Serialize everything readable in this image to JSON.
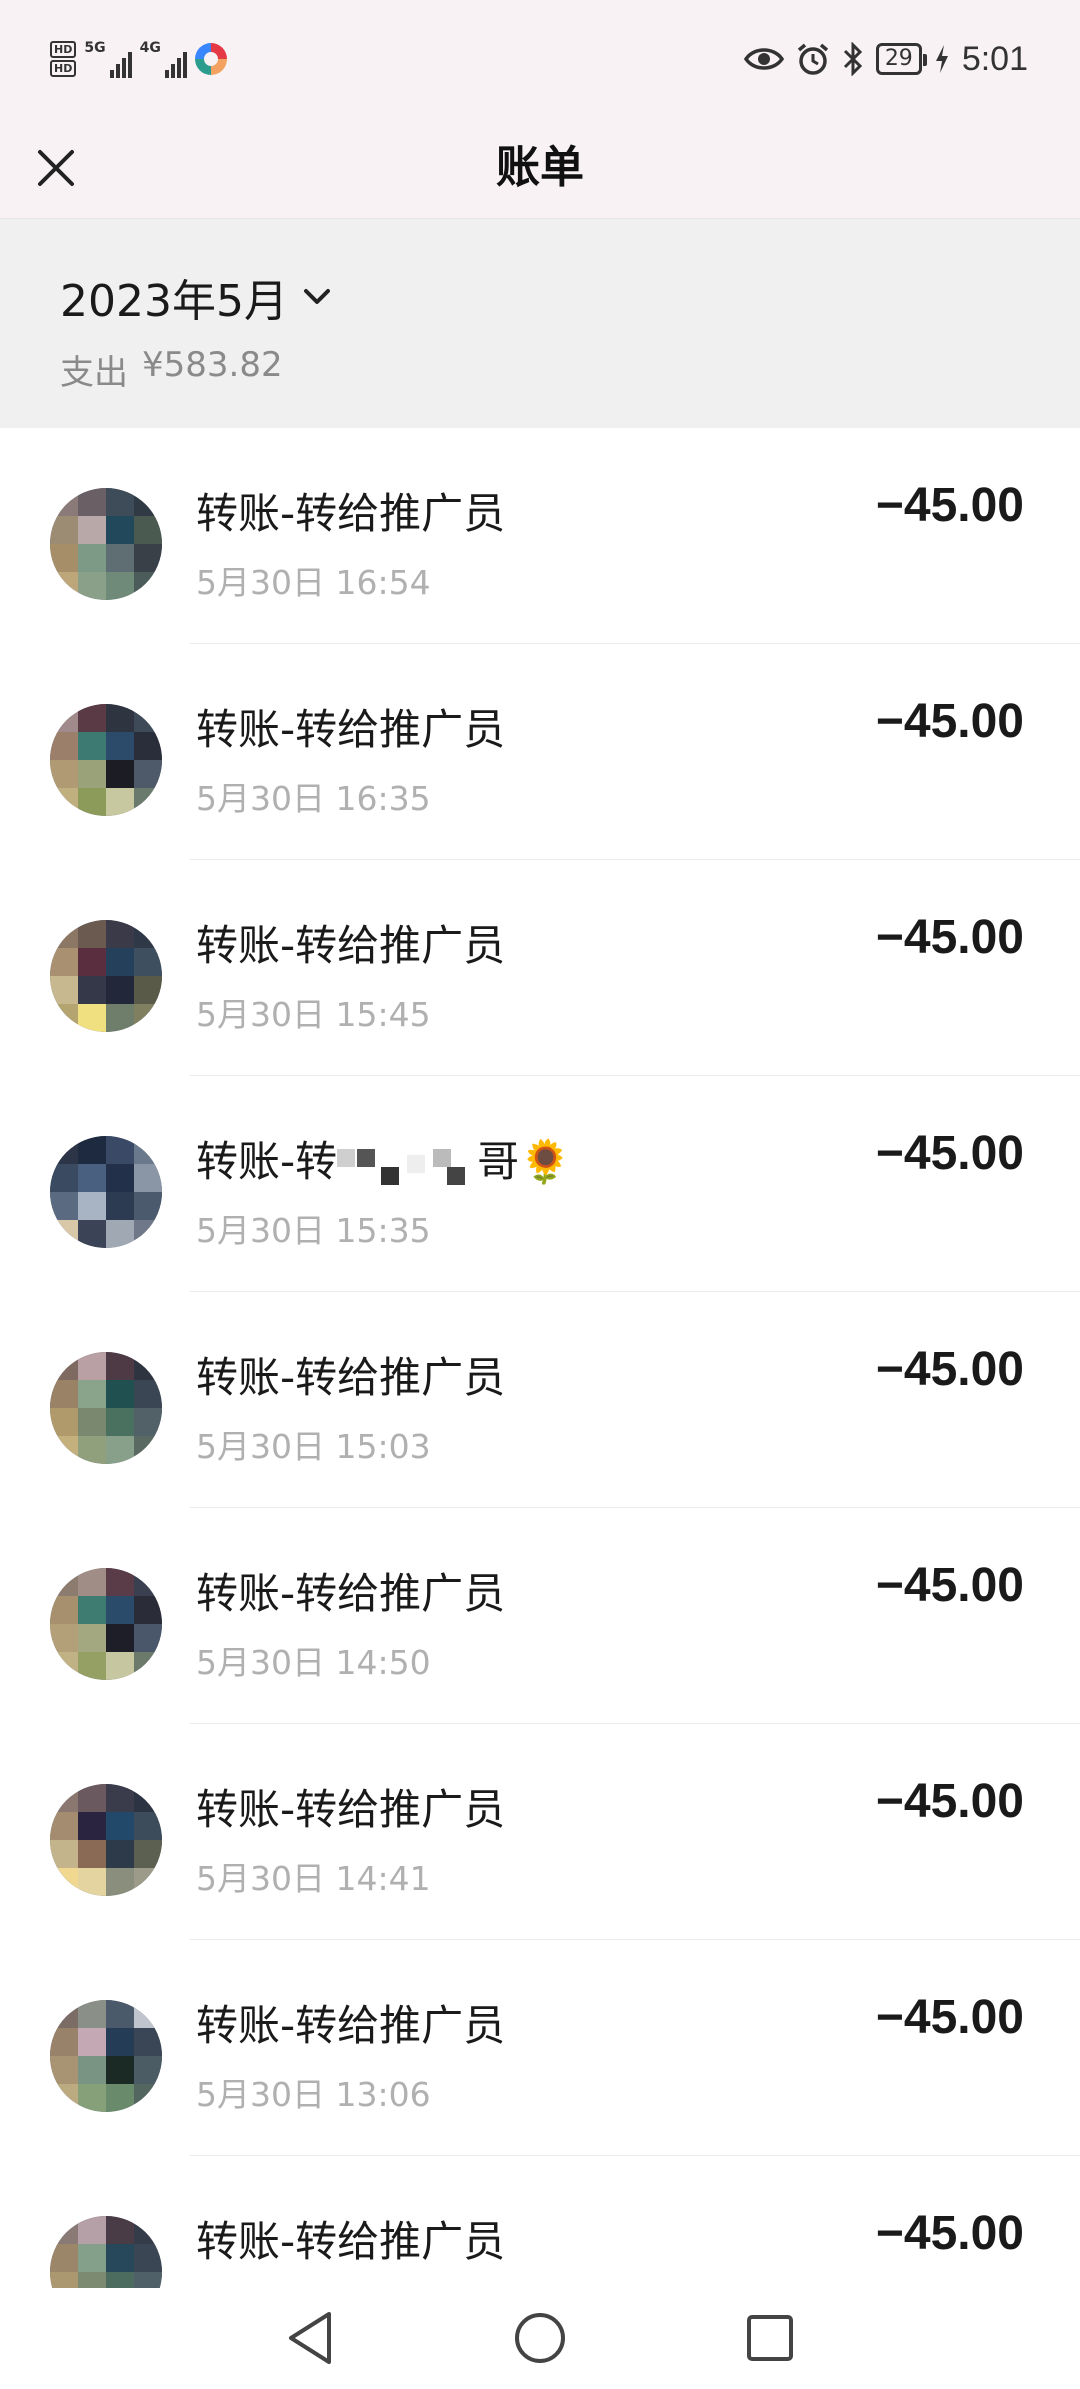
{
  "status_bar": {
    "hd_tags": [
      "HD",
      "HD"
    ],
    "network_1": "5G",
    "network_2": "4G",
    "battery_level": "29",
    "time": "5:01"
  },
  "header": {
    "title": "账单"
  },
  "summary": {
    "month": "2023年5月",
    "expense_label": "支出",
    "expense_amount": "¥583.82"
  },
  "transactions": [
    {
      "title": "转账-转给推广员",
      "time": "5月30日 16:54",
      "amount": "−45.00"
    },
    {
      "title": "转账-转给推广员",
      "time": "5月30日 16:35",
      "amount": "−45.00"
    },
    {
      "title": "转账-转给推广员",
      "time": "5月30日 15:45",
      "amount": "−45.00"
    },
    {
      "title_prefix": "转账-转",
      "title_suffix": "哥🌻",
      "time": "5月30日 15:35",
      "amount": "−45.00"
    },
    {
      "title": "转账-转给推广员",
      "time": "5月30日 15:03",
      "amount": "−45.00"
    },
    {
      "title": "转账-转给推广员",
      "time": "5月30日 14:50",
      "amount": "−45.00"
    },
    {
      "title": "转账-转给推广员",
      "time": "5月30日 14:41",
      "amount": "−45.00"
    },
    {
      "title": "转账-转给推广员",
      "time": "5月30日 13:06",
      "amount": "−45.00"
    },
    {
      "title": "转账-转给推广员",
      "time": "",
      "amount": "−45.00"
    }
  ],
  "nav_bar": {
    "icons": [
      "back-triangle-icon",
      "home-circle-icon",
      "recents-square-icon"
    ]
  }
}
